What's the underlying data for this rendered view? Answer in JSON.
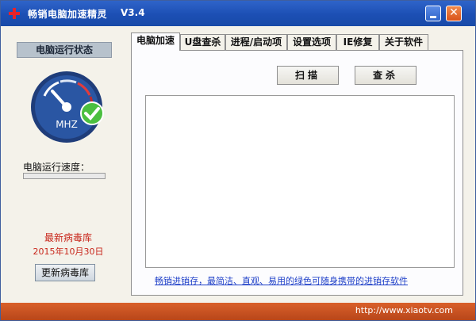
{
  "titlebar": {
    "title": "畅销电脑加速精灵",
    "version": "V3.4",
    "minimize_icon": "minimize-icon",
    "close_label": "✕"
  },
  "left": {
    "status_title": "电脑运行状态",
    "gauge_unit": "MHZ",
    "speed_label": "电脑运行速度：",
    "speed_progress": 0,
    "db_title": "最新病毒库",
    "db_date": "2015年10月30日",
    "update_button": "更新病毒库"
  },
  "tabs": [
    "电脑加速",
    "U盘查杀",
    "进程/启动项",
    "设置选项",
    "IE修复",
    "关于软件"
  ],
  "main": {
    "scan_button": "扫描",
    "kill_button": "查杀",
    "link_text": "畅销进销存，最简洁、直观、易用的绿色可随身携带的进销存软件"
  },
  "footer": {
    "url": "http://www.xiaotv.com"
  },
  "colors": {
    "titlebar": "#1c4fb4",
    "footer": "#c8501f",
    "db_text": "#c8261b",
    "link": "#1e3fc8"
  }
}
